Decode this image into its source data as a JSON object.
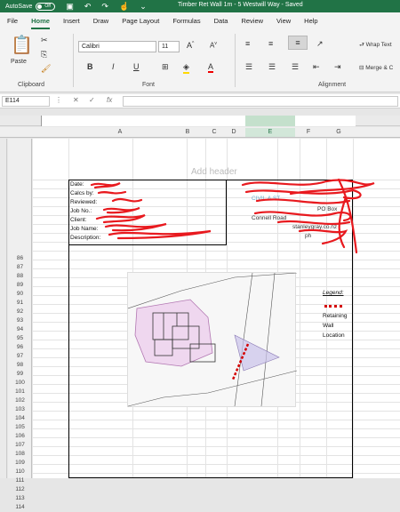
{
  "titlebar": {
    "autosave": "AutoSave",
    "toggle": "Off",
    "title": "Timber Ret Wall 1m - 5 Westwill Way  -  Saved"
  },
  "tabs": [
    "File",
    "Home",
    "Insert",
    "Draw",
    "Page Layout",
    "Formulas",
    "Data",
    "Review",
    "View",
    "Help"
  ],
  "ribbon": {
    "paste": "Paste",
    "clipboard": "Clipboard",
    "font_name": "Calibri",
    "font_size": "11",
    "font": "Font",
    "bold": "B",
    "italic": "I",
    "underline": "U",
    "wrap_text": "Wrap Text",
    "merge": "Merge & C",
    "alignment": "Alignment"
  },
  "formula_bar": {
    "name_box": "E114",
    "fx": "fx",
    "value": ""
  },
  "columns": [
    "A",
    "B",
    "C",
    "D",
    "E",
    "F",
    "G"
  ],
  "rows": [
    "86",
    "87",
    "88",
    "89",
    "90",
    "91",
    "92",
    "93",
    "94",
    "95",
    "96",
    "97",
    "98",
    "99",
    "100",
    "101",
    "102",
    "103",
    "104",
    "105",
    "106",
    "107",
    "108",
    "109",
    "110",
    "111",
    "112",
    "113",
    "114"
  ],
  "page": {
    "header_placeholder": "Add header",
    "info_labels": [
      "Date:",
      "Calcs by:",
      "Reviewed:",
      "Job No.:",
      "Client:",
      "Job Name:",
      "Description:"
    ],
    "company_lines": [
      "CIVIL & ST",
      "PO Box",
      "Connell Road",
      "stanleygray.co.nz",
      "ph"
    ],
    "legend_title": "Legend:",
    "legend_items": [
      "Retaining",
      "Wall",
      "Location"
    ]
  },
  "colors": {
    "excel_green": "#217346",
    "redact_red": "#e8191e",
    "wall_red": "#d40000"
  }
}
